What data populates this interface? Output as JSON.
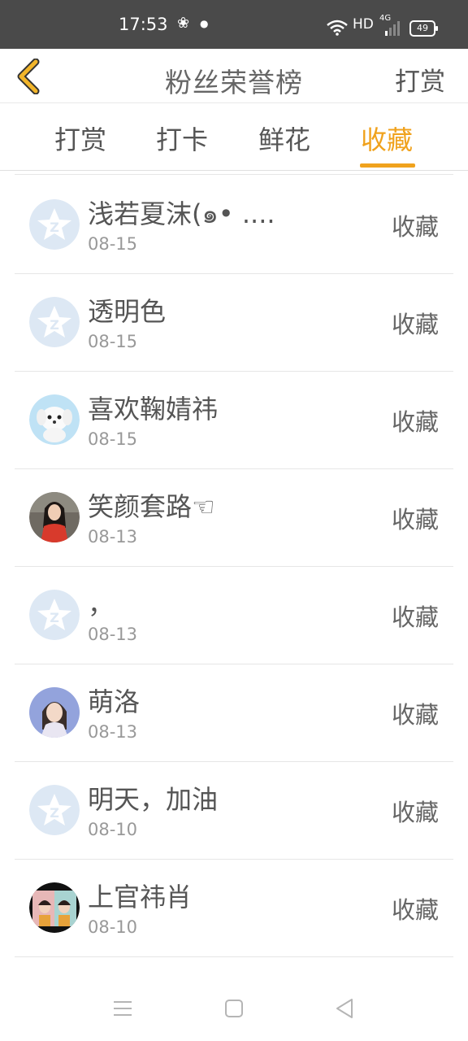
{
  "status_bar": {
    "time": "17:53",
    "hd": "HD",
    "network": "4G",
    "battery": "49"
  },
  "header": {
    "title": "粉丝荣誉榜",
    "action": "打赏"
  },
  "tabs": [
    {
      "label": "打赏",
      "active": false
    },
    {
      "label": "打卡",
      "active": false
    },
    {
      "label": "鲜花",
      "active": false
    },
    {
      "label": "收藏",
      "active": true
    }
  ],
  "list": [
    {
      "name": "浅若夏沫(๑• ....",
      "date": "08-15",
      "action": "收藏",
      "avatar": "default-avatar-icon"
    },
    {
      "name": "透明色",
      "date": "08-15",
      "action": "收藏",
      "avatar": "default-avatar-icon"
    },
    {
      "name": "喜欢鞠婧祎",
      "date": "08-15",
      "action": "收藏",
      "avatar": "dog-photo"
    },
    {
      "name": "笑颜套路☜",
      "date": "08-13",
      "action": "收藏",
      "avatar": "girl-photo-red"
    },
    {
      "name": "，",
      "date": "08-13",
      "action": "收藏",
      "avatar": "default-avatar-icon"
    },
    {
      "name": "萌洛",
      "date": "08-13",
      "action": "收藏",
      "avatar": "girl-photo-blue"
    },
    {
      "name": "明天，加油",
      "date": "08-10",
      "action": "收藏",
      "avatar": "default-avatar-icon"
    },
    {
      "name": "上官祎肖",
      "date": "08-10",
      "action": "收藏",
      "avatar": "couple-photo"
    }
  ],
  "colors": {
    "accent": "#f0a21d",
    "status_bar": "#4a4a4a",
    "back_icon": "#f2b52a"
  }
}
